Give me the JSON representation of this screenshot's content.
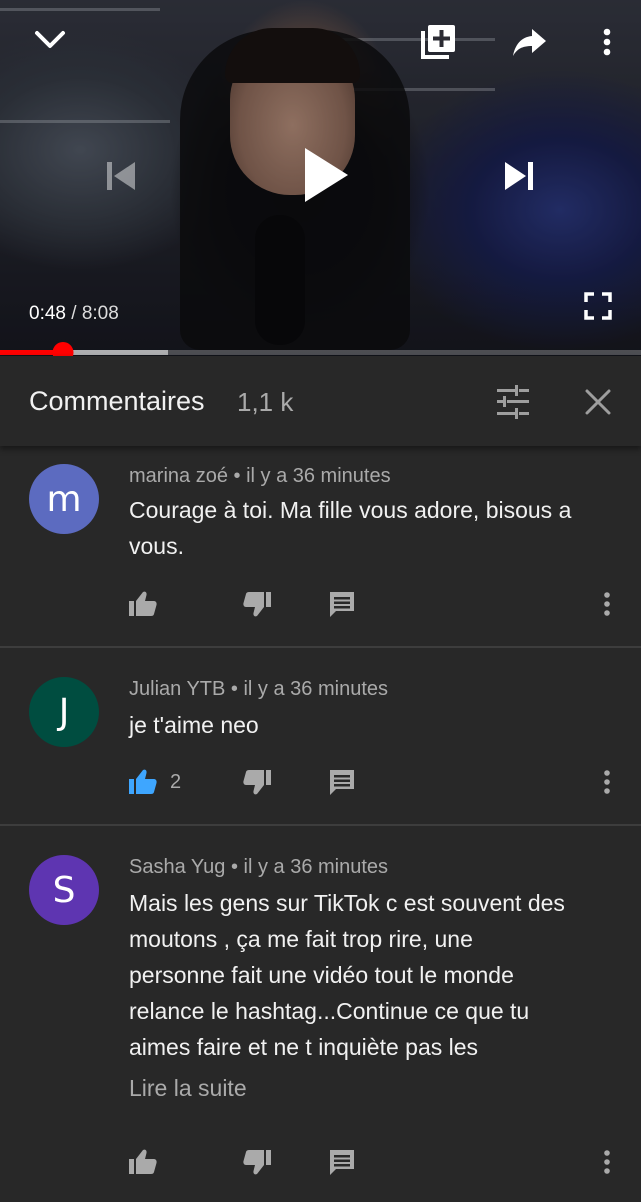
{
  "player": {
    "current_time": "0:48",
    "separator": "/",
    "duration": "8:08",
    "progress_fraction": 0.098,
    "buffer_fraction": 0.262,
    "accent": "#ff0000",
    "icons": {
      "collapse": "chevron-down-icon",
      "add_to_playlist": "playlist-add-icon",
      "share": "share-icon",
      "more": "more-vert-icon",
      "previous": "skip-previous-icon",
      "play": "play-icon",
      "next": "skip-next-icon",
      "fullscreen": "fullscreen-icon"
    }
  },
  "comments_panel": {
    "title": "Commentaires",
    "count": "1,1 k",
    "icons": {
      "sort": "tune-icon",
      "close": "close-icon"
    }
  },
  "comments": [
    {
      "avatar_letter": "m",
      "avatar_color": "#5c6bc0",
      "author": "marina zoé",
      "time": "il y a 36 minutes",
      "text": "Courage à toi.  Ma fille vous adore, bisous a vous.",
      "likes": "",
      "liked": false,
      "read_more": ""
    },
    {
      "avatar_letter": "J",
      "avatar_color": "#004d40",
      "author": "Julian YTB",
      "time": "il y a 36 minutes",
      "text": "je t'aime neo",
      "likes": "2",
      "liked": true,
      "read_more": ""
    },
    {
      "avatar_letter": "S",
      "avatar_color": "#5e35b1",
      "author": "Sasha Yug",
      "time": "il y a 36 minutes",
      "text": "Mais les gens sur TikTok c est souvent des moutons , ça me fait trop rire,  une personne fait une vidéo tout le monde relance le hashtag...Continue ce que tu aimes faire et ne t inquiète pas les",
      "likes": "",
      "liked": false,
      "read_more": "Lire la suite"
    }
  ],
  "colors": {
    "background": "#282828",
    "text_primary": "#f1f1f1",
    "text_secondary": "#aaaaaa",
    "liked_blue": "#3ea6ff",
    "divider": "#3d3d3d"
  }
}
